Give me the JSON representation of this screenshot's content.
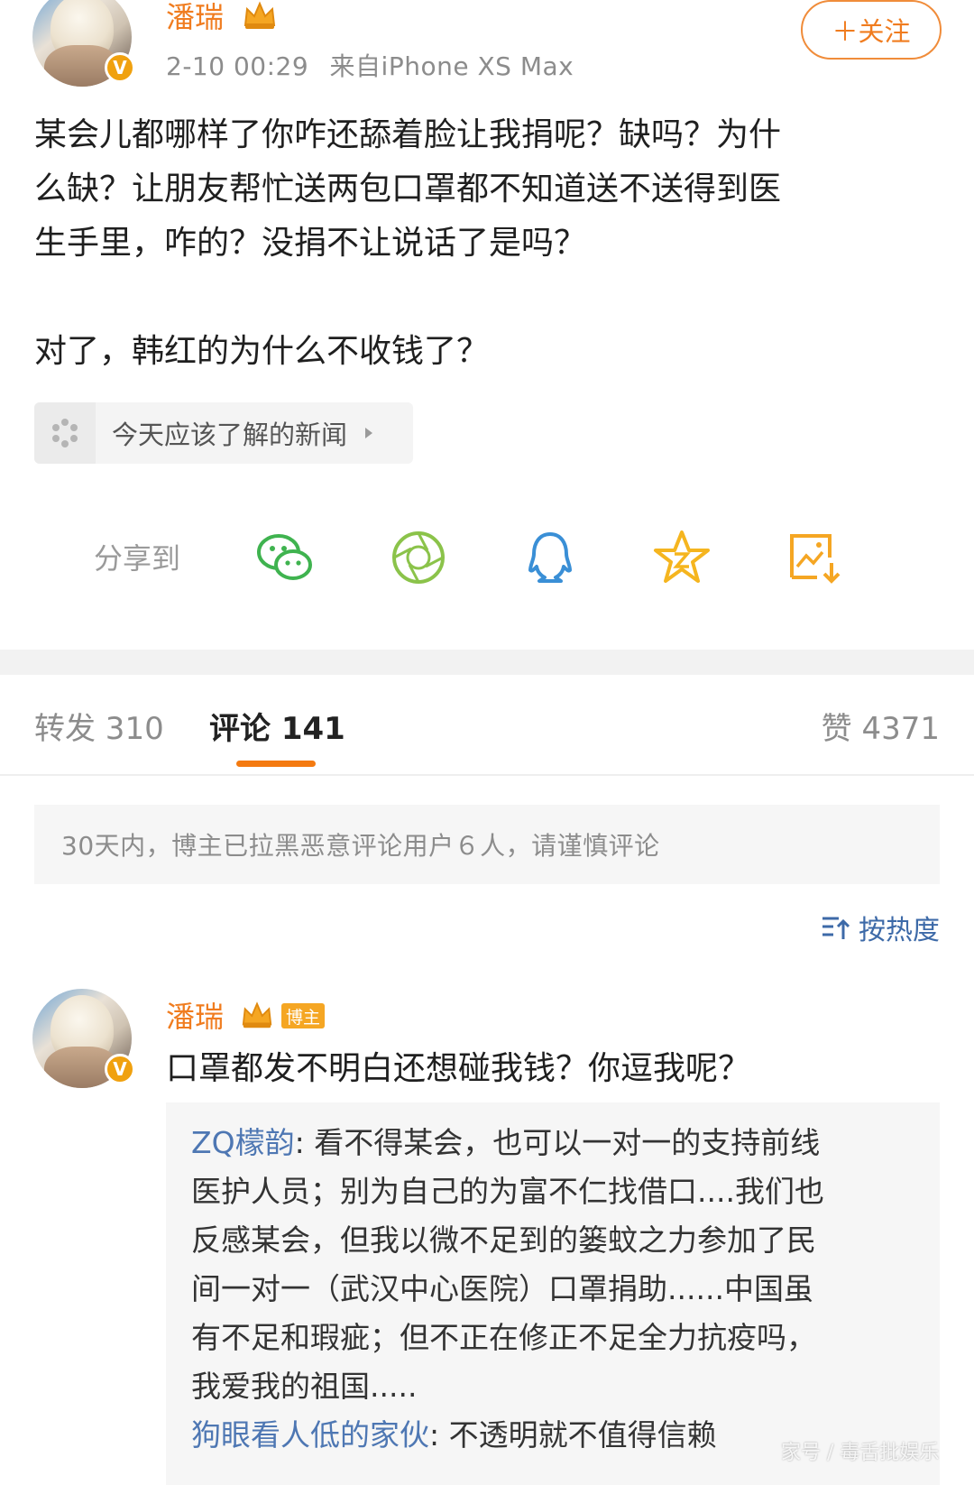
{
  "post": {
    "author": "潘瑞",
    "timestamp": "2-10 00:29",
    "source": "来自iPhone XS Max",
    "follow_label": "＋关注",
    "lines": [
      "某会儿都哪样了你咋还舔着脸让我捐呢？缺吗？为什",
      "么缺？让朋友帮忙送两包口罩都不知道送不送得到医",
      "生手里，咋的？没捐不让说话了是吗？",
      "对了，韩红的为什么不收钱了？"
    ],
    "topic_card": "今天应该了解的新闻"
  },
  "share": {
    "label": "分享到",
    "icons": [
      "wechat-icon",
      "moments-icon",
      "qq-icon",
      "qzone-icon",
      "save-image-icon"
    ]
  },
  "tabs": {
    "repost": "转发 310",
    "comment": "评论 141",
    "like": "赞 4371"
  },
  "notice": "30天内，博主已拉黑恶意评论用户６人，请谨慎评论",
  "sort_label": "按热度",
  "comment": {
    "author": "潘瑞",
    "badge": "博主",
    "text": "口罩都发不明白还想碰我钱？你逗我呢？",
    "replies": [
      {
        "user": "ZQ檬韵",
        "lines": [
          ": 看不得某会，也可以一对一的支持前线",
          "医护人员；别为自己的为富不仁找借口....我们也",
          "反感某会，但我以微不足到的篓蚊之力参加了民",
          "间一对一（武汉中心医院）口罩捐助......中国虽",
          "有不足和瑕疵；但不正在修正不足全力抗疫吗，",
          "我爱我的祖国....."
        ]
      },
      {
        "user": "狗眼看人低的家伙",
        "text": ": 不透明就不值得信赖"
      }
    ]
  },
  "watermark": "家号 / 毒舌批娱乐",
  "colors": {
    "accent_orange": "#f07c1f",
    "link_blue": "#4e77b3",
    "vip_gold": "#f5a623"
  }
}
